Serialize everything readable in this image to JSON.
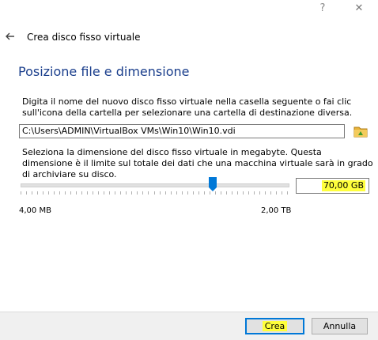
{
  "titlebar": {
    "help_label": "?",
    "close_label": "✕"
  },
  "header": {
    "title": "Crea disco fisso virtuale"
  },
  "section": {
    "title": "Posizione file e dimensione"
  },
  "location": {
    "description": "Digita il nome del nuovo disco fisso virtuale nella casella seguente o fai clic sull'icona della cartella per selezionare una cartella di destinazione diversa.",
    "path": "C:\\Users\\ADMIN\\VirtualBox VMs\\Win10\\Win10.vdi"
  },
  "size": {
    "description": "Seleziona la dimensione del disco fisso virtuale in megabyte. Questa dimensione è il limite sul totale dei dati che una macchina virtuale sarà in grado di archiviare su disco.",
    "min_label": "4,00 MB",
    "max_label": "2,00 TB",
    "value": "70,00 GB",
    "slider_fraction": 0.72
  },
  "buttons": {
    "create": "Crea",
    "cancel": "Annulla"
  },
  "colors": {
    "accent": "#0078d7",
    "highlight": "#ffff3c",
    "title_blue": "#1a3e8c"
  }
}
